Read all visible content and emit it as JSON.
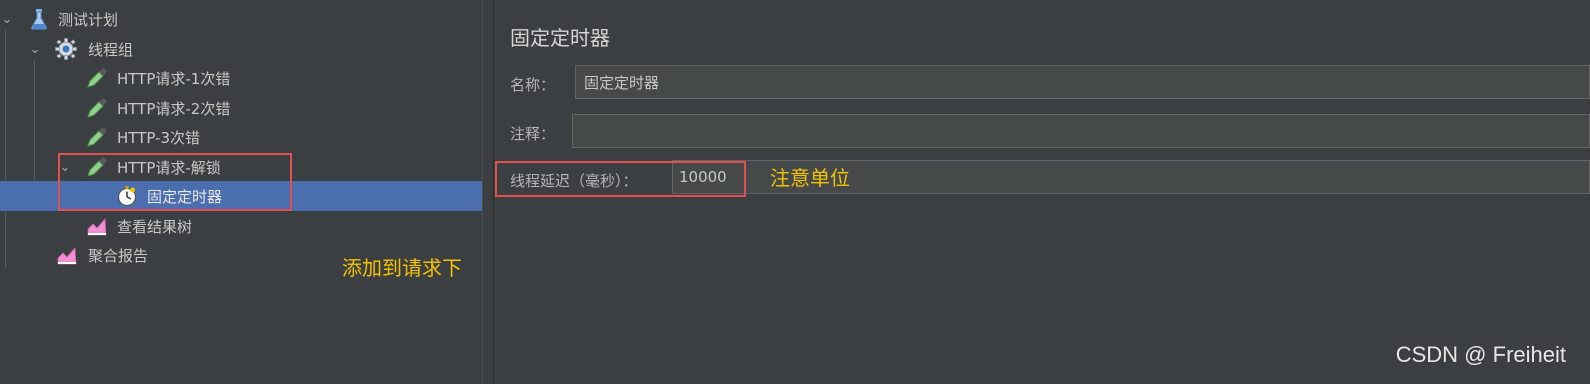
{
  "tree": {
    "items": [
      {
        "label": "测试计划",
        "icon": "flask-icon",
        "expanded": true
      },
      {
        "label": "线程组",
        "icon": "gear-icon",
        "expanded": true
      },
      {
        "label": "HTTP请求-1次错",
        "icon": "pipette-icon"
      },
      {
        "label": "HTTP请求-2次错",
        "icon": "pipette-icon"
      },
      {
        "label": "HTTP-3次错",
        "icon": "pipette-icon"
      },
      {
        "label": "HTTP请求-解锁",
        "icon": "pipette-icon",
        "expanded": true
      },
      {
        "label": "固定定时器",
        "icon": "timer-icon",
        "selected": true
      },
      {
        "label": "查看结果树",
        "icon": "chart-icon"
      },
      {
        "label": "聚合报告",
        "icon": "chart-icon"
      }
    ]
  },
  "annotations": {
    "add_under_request": "添加到请求下",
    "note_unit": "注意单位"
  },
  "panel": {
    "title": "固定定时器",
    "name_label": "名称：",
    "name_value": "固定定时器",
    "comment_label": "注释：",
    "comment_value": "",
    "delay_label": "线程延迟（毫秒）：",
    "delay_value": "10000"
  },
  "watermark": "CSDN @ Freiheit",
  "colors": {
    "selection": "#4b6eaf",
    "highlight_box": "#e05252",
    "annotation_text": "#f2c200"
  }
}
